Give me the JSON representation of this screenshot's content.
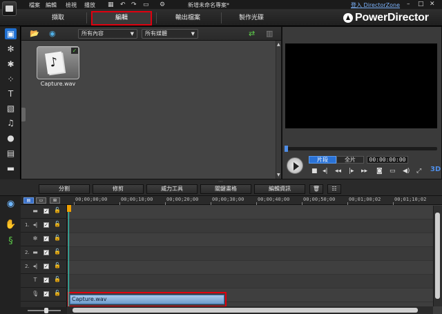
{
  "menu": {
    "file": "檔案",
    "edit": "編輯",
    "view": "檢視",
    "play": "播放"
  },
  "title_bar": {
    "project_title": "新增未命名專案*",
    "login_link": "登入 DirectorZone",
    "minimize": "–",
    "maximize": "□",
    "close": "✕"
  },
  "modes": {
    "capture": "擷取",
    "edit": "編輯",
    "produce": "輸出檔案",
    "create_disc": "製作光碟"
  },
  "brand": {
    "name": "PowerDirector"
  },
  "library": {
    "filter_content": "所有內容",
    "filter_media": "所有媒體",
    "items": [
      {
        "label": "Capture.wav"
      }
    ]
  },
  "preview": {
    "clip_label": "片段",
    "movie_label": "全片",
    "timecode": "00:00:00:00",
    "badge_3d": "3D"
  },
  "edit_toolbar": {
    "split": "分割",
    "trim": "修剪",
    "power_tools": "威力工具",
    "keyframe": "關鍵畫格",
    "edit_info": "編輯資訊"
  },
  "timeline": {
    "ruler": [
      "00;00;00;00",
      "00;00;10;00",
      "00;00;20;00",
      "00;00;30;00",
      "00;00;40;00",
      "00;00;50;00",
      "00;01;00;02",
      "00;01;10;02"
    ],
    "tracks": [
      {
        "num": "",
        "type": "video"
      },
      {
        "num": "1.",
        "type": "audio"
      },
      {
        "num": "",
        "type": "effect"
      },
      {
        "num": "2.",
        "type": "video"
      },
      {
        "num": "2.",
        "type": "audio"
      },
      {
        "num": "",
        "type": "title"
      },
      {
        "num": "",
        "type": "voice"
      }
    ],
    "audio_clip": "Capture.wav"
  },
  "icons": {
    "video_track": "▬",
    "audio_track": "◂|",
    "effect_track": "✻",
    "title_track": "T",
    "voice_track": "🎙",
    "lock": "🔓",
    "check": "✓"
  },
  "colors": {
    "accent_blue": "#2a72d6",
    "highlight_red": "#e1000f",
    "playhead": "#2ee0c8"
  }
}
